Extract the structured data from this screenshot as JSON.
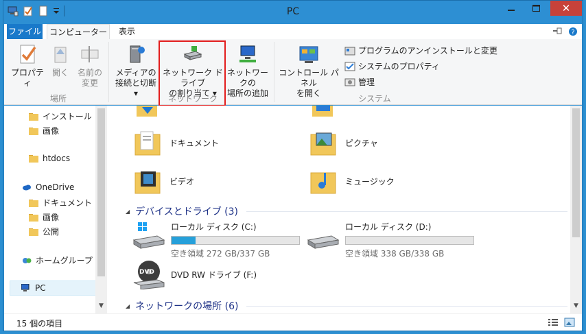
{
  "window": {
    "title": "PC"
  },
  "controls": {
    "close": "✕"
  },
  "tabs": [
    {
      "label": "ファイル"
    },
    {
      "label": "コンピューター"
    },
    {
      "label": "表示"
    }
  ],
  "ribbon": {
    "location": {
      "group_label": "場所",
      "properties": "プロパティ",
      "open": "開く",
      "rename_line1": "名前の",
      "rename_line2": "変更"
    },
    "network": {
      "group_label": "ネットワーク",
      "media_line1": "メディアの",
      "media_line2": "接続と切断 ▾",
      "map_drive_line1": "ネットワーク ドライブ",
      "map_drive_line2": "の割り当て ▾",
      "add_location_line1": "ネットワークの",
      "add_location_line2": "場所の追加"
    },
    "system": {
      "group_label": "システム",
      "control_panel_line1": "コントロール パネル",
      "control_panel_line2": "を開く",
      "uninstall": "プログラムのアンインストールと変更",
      "system_properties": "システムのプロパティ",
      "manage": "管理"
    }
  },
  "nav": {
    "items": [
      {
        "label": "インストール"
      },
      {
        "label": "画像"
      },
      {
        "label": "htdocs"
      },
      {
        "label": "OneDrive"
      },
      {
        "label": "ドキュメント"
      },
      {
        "label": "画像"
      },
      {
        "label": "公開"
      },
      {
        "label": "ホームグループ"
      },
      {
        "label": "PC"
      }
    ]
  },
  "folders": [
    {
      "label": "ドキュメント"
    },
    {
      "label": "ピクチャ"
    },
    {
      "label": "ビデオ"
    },
    {
      "label": "ミュージック"
    }
  ],
  "devices_section": {
    "title": "デバイスとドライブ (3)"
  },
  "drives": [
    {
      "name": "ローカル ディスク (C:)",
      "free_text": "空き領域 272 GB/337 GB",
      "used_fraction": 0.19
    },
    {
      "name": "ローカル ディスク (D:)",
      "free_text": "空き領域 338 GB/338 GB",
      "used_fraction": 0.0
    },
    {
      "name": "DVD RW ドライブ (F:)",
      "badge": "DVD"
    }
  ],
  "network_section": {
    "title": "ネットワークの場所 (6)"
  },
  "status": {
    "count": "15 個の項目"
  },
  "colors": {
    "accent": "#1979ca",
    "drive_bar": "#26a0da",
    "highlight": "#e21d1d",
    "close": "#c7423a"
  }
}
